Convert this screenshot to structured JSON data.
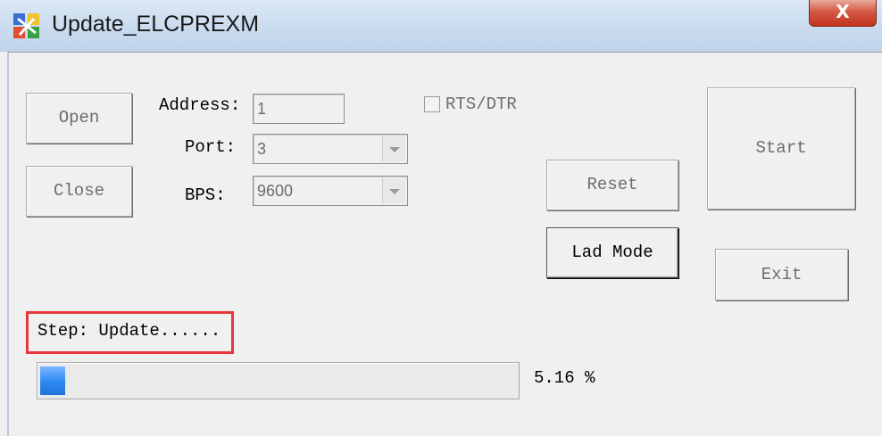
{
  "window": {
    "title": "Update_ELCPREXM",
    "close_label": "X"
  },
  "buttons": {
    "open": "Open",
    "close": "Close",
    "start": "Start",
    "reset": "Reset",
    "lad_mode": "Lad Mode",
    "exit": "Exit"
  },
  "form": {
    "address_label": "Address:",
    "address_value": "1",
    "port_label": "Port:",
    "port_value": "3",
    "bps_label": "BPS:",
    "bps_value": "9600",
    "rts_dtr_label": "RTS/DTR",
    "rts_dtr_checked": false
  },
  "status": {
    "step_text": "Step: Update......",
    "progress_percent": 5.16,
    "progress_label": "5.16 %"
  },
  "colors": {
    "highlight_border": "#e8363d",
    "progress_fill": "#2f8cf5",
    "disabled_text": "#6d6d6d"
  }
}
